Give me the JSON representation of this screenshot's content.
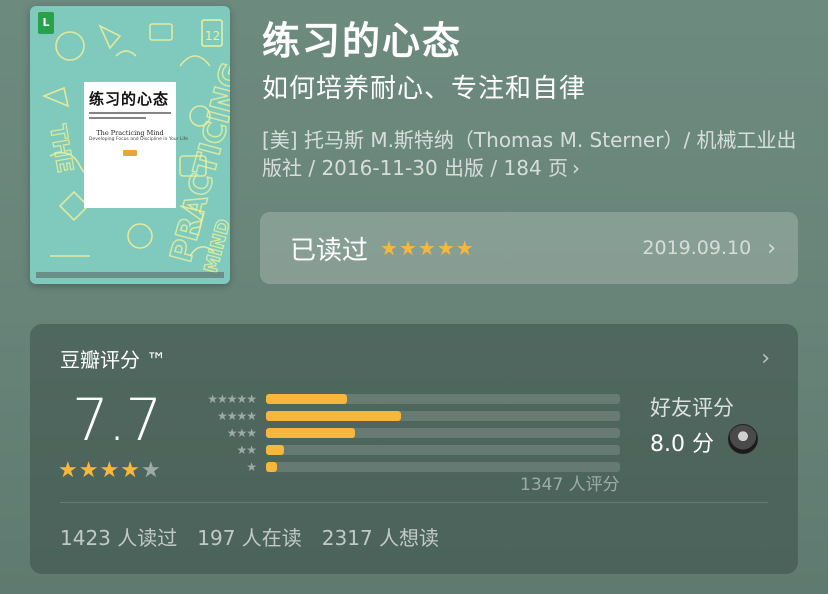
{
  "cover": {
    "badge": "L",
    "title": "练习的心态",
    "title_en": "The Practicing Mind",
    "subtitle_en": "Developing Focus and Discipline in Your Life",
    "doodle_number": "12"
  },
  "book": {
    "title": "练习的心态",
    "subtitle": "如何培养耐心、专注和自律",
    "meta": "[美] 托马斯 M.斯特纳（Thomas M. Sterner）/ 机械工业出版社 / 2016-11-30 出版 / 184 页",
    "meta_chevron": "›"
  },
  "read_status": {
    "label": "已读过",
    "stars": 5,
    "date": "2019.09.10",
    "chevron": "›"
  },
  "rating": {
    "label": "豆瓣评分 ™",
    "chevron": "›",
    "score": "7.7",
    "stars_filled": 4,
    "stars_total": 5,
    "distribution": [
      {
        "stars": 5,
        "percent": 23
      },
      {
        "stars": 4,
        "percent": 38
      },
      {
        "stars": 3,
        "percent": 25
      },
      {
        "stars": 2,
        "percent": 5
      },
      {
        "stars": 1,
        "percent": 3
      }
    ],
    "count": "1347 人评分",
    "friend_label": "好友评分",
    "friend_score": "8.0 分"
  },
  "stats": {
    "read": "1423 人读过",
    "reading": "197 人在读",
    "want": "2317 人想读"
  },
  "colors": {
    "star": "#f6b73c",
    "background": "#6d8a7f",
    "cover": "#7fc9bd"
  },
  "icons": [
    "book-cover-image",
    "chevron-right-icon",
    "star-icon",
    "friend-avatar"
  ]
}
